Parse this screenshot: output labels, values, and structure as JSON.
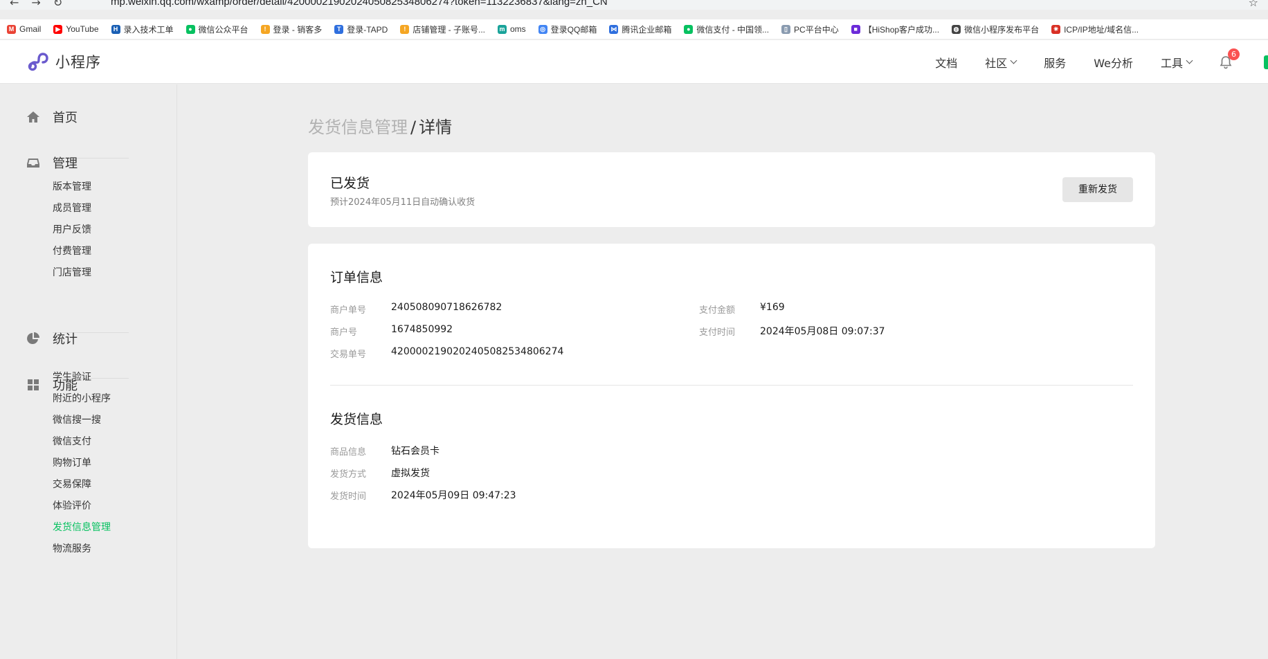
{
  "browser": {
    "back": "←",
    "forward": "→",
    "reload": "↻",
    "url": "mp.weixin.qq.com/wxamp/order/detail/4200002190202405082534806274?token=1132236837&lang=zh_CN",
    "star": "☆"
  },
  "bookmarks": [
    {
      "label": "Gmail",
      "color": "#ea4335",
      "glyph": "M"
    },
    {
      "label": "YouTube",
      "color": "#ff0000",
      "glyph": "▶"
    },
    {
      "label": "录入技术工单",
      "color": "#1a5fb4",
      "glyph": "H"
    },
    {
      "label": "微信公众平台",
      "color": "#07c160",
      "glyph": "●"
    },
    {
      "label": "登录 - 销客多",
      "color": "#f5a623",
      "glyph": "!"
    },
    {
      "label": "登录-TAPD",
      "color": "#2f6fde",
      "glyph": "T"
    },
    {
      "label": "店铺管理 - 子账号...",
      "color": "#f5a623",
      "glyph": "!"
    },
    {
      "label": "oms",
      "color": "#1aa39a",
      "glyph": "m"
    },
    {
      "label": "登录QQ邮箱",
      "color": "#4285f4",
      "glyph": "◎"
    },
    {
      "label": "腾讯企业邮箱",
      "color": "#2f6fde",
      "glyph": "⋈"
    },
    {
      "label": "微信支付 - 中国领...",
      "color": "#07c160",
      "glyph": "●"
    },
    {
      "label": "PC平台中心",
      "color": "#8a9bb0",
      "glyph": "▯"
    },
    {
      "label": "【HiShop客户成功...",
      "color": "#6c2bd9",
      "glyph": "■"
    },
    {
      "label": "微信小程序发布平台",
      "color": "#444444",
      "glyph": "◍"
    },
    {
      "label": "ICP/IP地址/域名信...",
      "color": "#d93025",
      "glyph": "✷"
    }
  ],
  "app": {
    "logo_text": "小程序",
    "nav": [
      {
        "label": "文档",
        "dropdown": false
      },
      {
        "label": "社区",
        "dropdown": true
      },
      {
        "label": "服务",
        "dropdown": false
      },
      {
        "label": "We分析",
        "dropdown": false
      },
      {
        "label": "工具",
        "dropdown": true
      }
    ],
    "notification_count": "6"
  },
  "sidebar": {
    "home": "首页",
    "manage": {
      "label": "管理",
      "items": [
        "版本管理",
        "成员管理",
        "用户反馈",
        "付费管理",
        "门店管理"
      ]
    },
    "stats": "统计",
    "features": {
      "label": "功能",
      "items": [
        "学生验证",
        "附近的小程序",
        "微信搜一搜",
        "微信支付",
        "购物订单",
        "交易保障",
        "体验评价",
        "发货信息管理",
        "物流服务"
      ],
      "active": "发货信息管理"
    }
  },
  "breadcrumb": {
    "parent": "发货信息管理",
    "sep": "/",
    "current": "详情"
  },
  "status": {
    "title": "已发货",
    "subtitle": "预计2024年05月11日自动确认收货",
    "resend_label": "重新发货"
  },
  "order": {
    "title": "订单信息",
    "merchant_order_label": "商户单号",
    "merchant_order": "240508090718626782",
    "merchant_id_label": "商户号",
    "merchant_id": "1674850992",
    "transaction_label": "交易单号",
    "transaction": "4200002190202405082534806274",
    "amount_label": "支付金额",
    "amount": "¥169",
    "pay_time_label": "支付时间",
    "pay_time": "2024年05月08日 09:07:37"
  },
  "shipping": {
    "title": "发货信息",
    "product_label": "商品信息",
    "product": "钻石会员卡",
    "method_label": "发货方式",
    "method": "虚拟发货",
    "time_label": "发货时间",
    "time": "2024年05月09日 09:47:23"
  },
  "colors": {
    "accent": "#07c160",
    "badge": "#fa5151",
    "logo": "#6a5acd"
  }
}
